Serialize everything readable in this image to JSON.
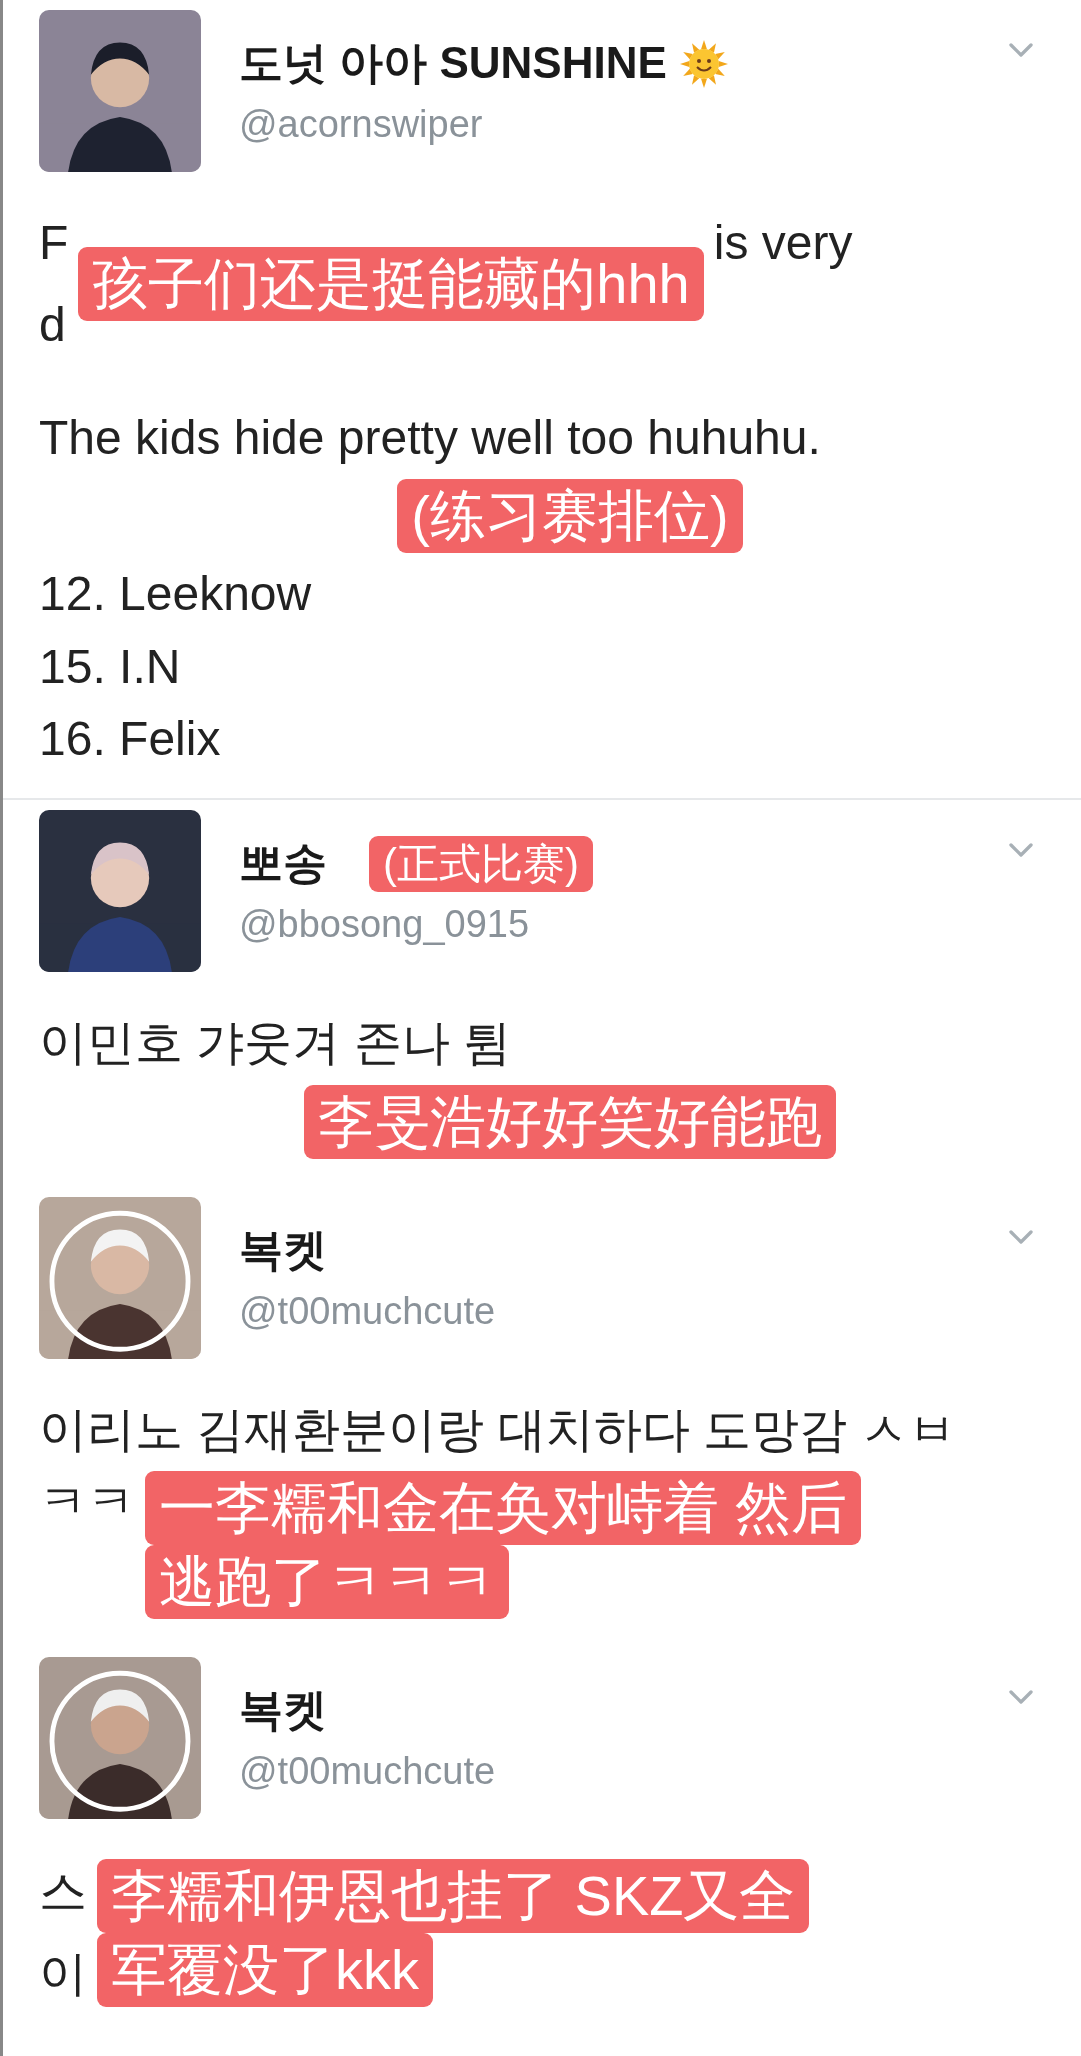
{
  "tweets": [
    {
      "kind": "sun_name",
      "name": "도넛 아아 SUNSHINE",
      "handle": "@acornswiper",
      "divider_after": true,
      "body": [
        {
          "kind": "split",
          "left": [
            "F",
            "d"
          ],
          "caption": [
            "孩子们还是挺能藏的hhh"
          ],
          "right": "is very"
        },
        {
          "kind": "paragraph",
          "text": "The kids hide pretty well too huhuhu."
        },
        {
          "kind": "caption",
          "caption": [
            "(练习赛排位)"
          ]
        },
        {
          "kind": "line",
          "text": "12. Leeknow"
        },
        {
          "kind": "line",
          "text": "15. I.N"
        },
        {
          "kind": "line",
          "text": "16. Felix"
        }
      ]
    },
    {
      "kind": "plain",
      "name": "뽀송",
      "name_caption": "(正式比赛)",
      "handle": "@bbosong_0915",
      "divider_after": false,
      "body": [
        {
          "kind": "line",
          "text": "이민호 갸웃겨 존나 튐"
        },
        {
          "kind": "caption",
          "caption": [
            "李旻浩好好笑好能跑"
          ]
        }
      ]
    },
    {
      "kind": "plain",
      "name": "복켓",
      "handle": "@t00muchcute",
      "divider_after": false,
      "body": [
        {
          "kind": "line",
          "text": "이리노 김재환분이랑 대치하다 도망감 ㅅㅂ"
        },
        {
          "kind": "lead",
          "left": [
            "ㅋㅋ"
          ],
          "caption": [
            "一李糯和金在奂对峙着 然后",
            "逃跑了ㅋㅋㅋ"
          ]
        }
      ]
    },
    {
      "kind": "plain",
      "name": "복켓",
      "handle": "@t00muchcute",
      "divider_after": false,
      "body": [
        {
          "kind": "split",
          "left": [
            "스",
            "이"
          ],
          "caption": [
            "李糯和伊恩也挂了 SKZ又全",
            "军覆没了kkk"
          ]
        }
      ]
    }
  ]
}
